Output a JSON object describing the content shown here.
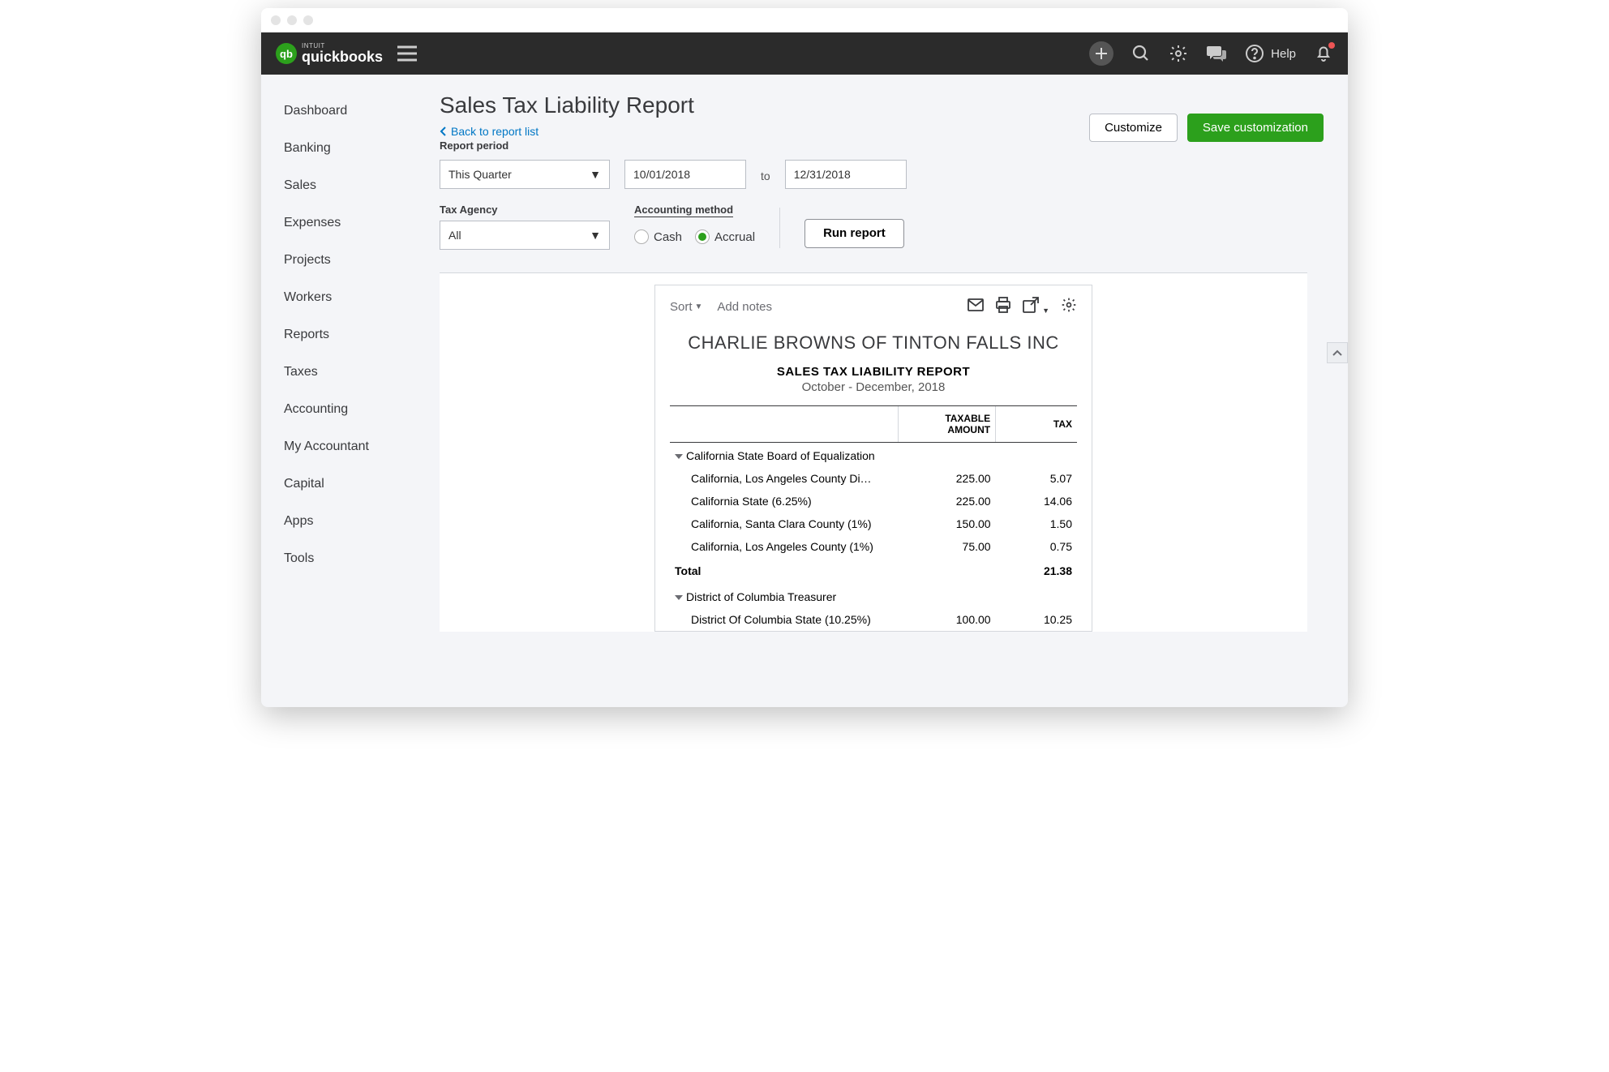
{
  "brand": {
    "intuit": "INTUIT",
    "name": "quickbooks",
    "qb": "qb"
  },
  "topbar": {
    "help": "Help"
  },
  "sidebar": {
    "items": [
      "Dashboard",
      "Banking",
      "Sales",
      "Expenses",
      "Projects",
      "Workers",
      "Reports",
      "Taxes",
      "Accounting",
      "My Accountant",
      "Capital",
      "Apps",
      "Tools"
    ]
  },
  "page": {
    "title": "Sales Tax Liability Report",
    "back": "Back to report list",
    "period_label": "Report period",
    "period_value": "This Quarter",
    "date_from": "10/01/2018",
    "to": "to",
    "date_to": "12/31/2018",
    "agency_label": "Tax Agency",
    "agency_value": "All",
    "acct_label": "Accounting method",
    "cash": "Cash",
    "accrual": "Accrual",
    "run": "Run report",
    "customize": "Customize",
    "save": "Save customization"
  },
  "report": {
    "sort": "Sort",
    "add_notes": "Add notes",
    "company": "CHARLIE BROWNS OF TINTON FALLS INC",
    "name": "SALES TAX LIABILITY REPORT",
    "range": "October - December, 2018",
    "col_amount": "TAXABLE AMOUNT",
    "col_tax": "TAX",
    "groups": [
      {
        "name": "California State Board of Equalization",
        "rows": [
          {
            "name": "California, Los Angeles County Di…",
            "amount": "225.00",
            "tax": "5.07"
          },
          {
            "name": "California State (6.25%)",
            "amount": "225.00",
            "tax": "14.06"
          },
          {
            "name": "California, Santa Clara County (1%)",
            "amount": "150.00",
            "tax": "1.50"
          },
          {
            "name": "California, Los Angeles County (1%)",
            "amount": "75.00",
            "tax": "0.75"
          }
        ],
        "total_label": "Total",
        "total_tax": "21.38"
      },
      {
        "name": "District of Columbia Treasurer",
        "rows": [
          {
            "name": "District Of Columbia State (10.25%)",
            "amount": "100.00",
            "tax": "10.25"
          }
        ]
      }
    ]
  }
}
